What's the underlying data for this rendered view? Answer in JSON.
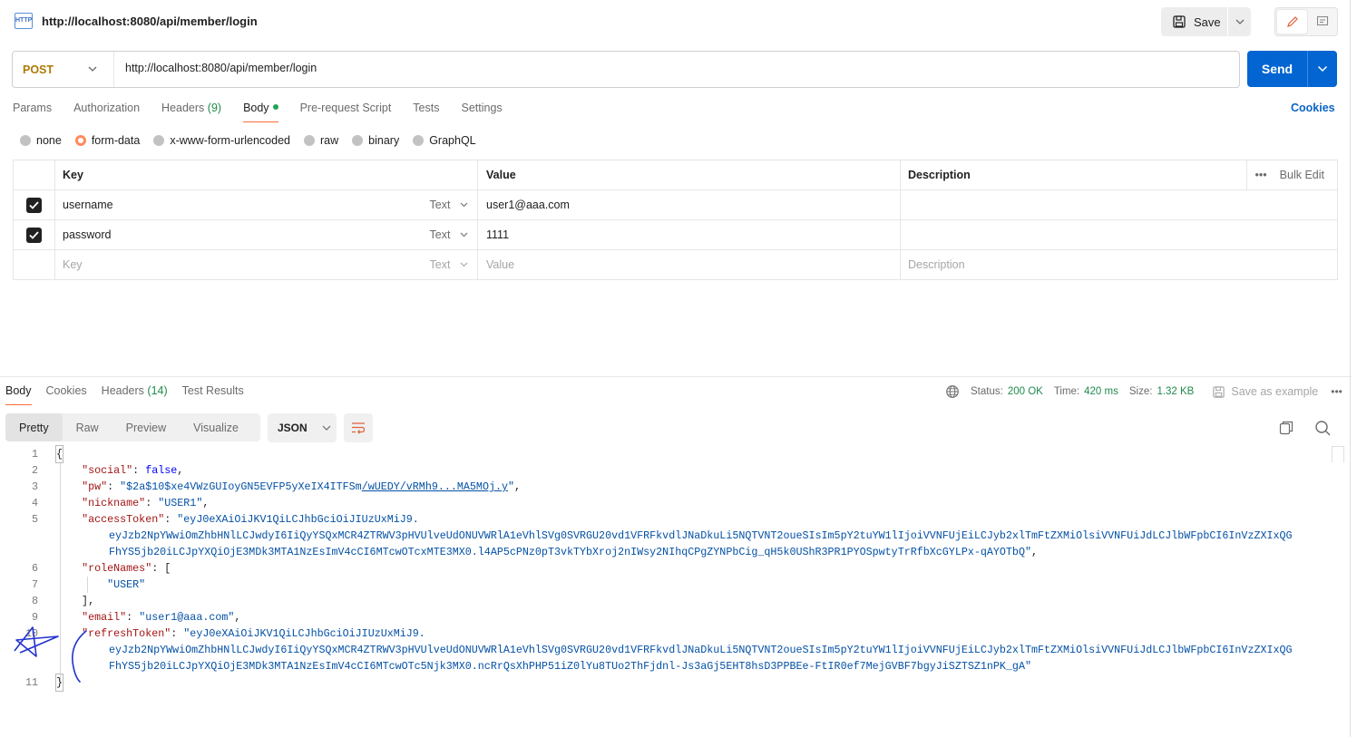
{
  "tab": {
    "icon": "http-icon",
    "icon_text": "HTTP",
    "title": "http://localhost:8080/api/member/login"
  },
  "toolbar": {
    "save_label": "Save"
  },
  "request": {
    "method": "POST",
    "url": "http://localhost:8080/api/member/login",
    "send_label": "Send",
    "tabs": [
      {
        "label": "Params"
      },
      {
        "label": "Authorization"
      },
      {
        "label": "Headers",
        "count": "(9)"
      },
      {
        "label": "Body"
      },
      {
        "label": "Pre-request Script"
      },
      {
        "label": "Tests"
      },
      {
        "label": "Settings"
      }
    ],
    "cookies_label": "Cookies",
    "body_types": [
      "none",
      "form-data",
      "x-www-form-urlencoded",
      "raw",
      "binary",
      "GraphQL"
    ],
    "selected_body_type": "form-data",
    "table": {
      "headers": {
        "key": "Key",
        "value": "Value",
        "description": "Description",
        "bulk_edit": "Bulk Edit"
      },
      "rows": [
        {
          "checked": true,
          "key": "username",
          "type": "Text",
          "value": "user1@aaa.com",
          "description": ""
        },
        {
          "checked": true,
          "key": "password",
          "type": "Text",
          "value": "1111",
          "description": ""
        }
      ],
      "placeholder": {
        "key": "Key",
        "type": "Text",
        "value": "Value",
        "description": "Description"
      }
    }
  },
  "response": {
    "tabs": [
      {
        "label": "Body"
      },
      {
        "label": "Cookies"
      },
      {
        "label": "Headers",
        "count": "(14)"
      },
      {
        "label": "Test Results"
      }
    ],
    "status_label": "Status:",
    "status": "200 OK",
    "time_label": "Time:",
    "time": "420 ms",
    "size_label": "Size:",
    "size": "1.32 KB",
    "save_example": "Save as example",
    "formats": [
      "Pretty",
      "Raw",
      "Preview",
      "Visualize"
    ],
    "active_format": "Pretty",
    "language": "JSON",
    "code": {
      "social_key": "\"social\"",
      "social_val": "false",
      "pw_key": "\"pw\"",
      "pw_a": "\"$2a$10$xe4VWzGUIoyGN5EVFP5yXeIX4ITFSm",
      "pw_b": "/wUEDY/vRMh9...MA5MOj.y",
      "pw_c": "\"",
      "nickname_key": "\"nickname\"",
      "nickname_val": "\"USER1\"",
      "access_key": "\"accessToken\"",
      "access_1": "\"eyJ0eXAiOiJKV1QiLCJhbGciOiJIUzUxMiJ9.",
      "access_2": "eyJzb2NpYWwiOmZhbHNlLCJwdyI6IiQyYSQxMCR4ZTRWV3pHVUlveUdONUVWRlA1eVhlSVg0SVRGU20vd1VFRFkvdlJNaDkuLi5NQTVNT2oueSIsIm5pY2tuYW1lIjoiVVNFUjEiLCJyb2xlTmFtZXMiOlsiVVNFUiJdLCJlbWFpbCI6InVzZXIxQG",
      "access_3": "FhYS5jb20iLCJpYXQiOjE3MDk3MTA1NzEsImV4cCI6MTcwOTcxMTE3MX0.l4AP5cPNz0pT3vkTYbXroj2nIWsy2NIhqCPgZYNPbCig_qH5k0UShR3PR1PYOSpwtyTrRfbXcGYLPx-qAYOTbQ\"",
      "roles_key": "\"roleNames\"",
      "roles_val": "\"USER\"",
      "email_key": "\"email\"",
      "email_val": "\"user1@aaa.com\"",
      "refresh_key": "\"refreshToken\"",
      "refresh_1": "\"eyJ0eXAiOiJKV1QiLCJhbGciOiJIUzUxMiJ9.",
      "refresh_2": "eyJzb2NpYWwiOmZhbHNlLCJwdyI6IiQyYSQxMCR4ZTRWV3pHVUlveUdONUVWRlA1eVhlSVg0SVRGU20vd1VFRFkvdlJNaDkuLi5NQTVNT2oueSIsIm5pY2tuYW1lIjoiVVNFUjEiLCJyb2xlTmFtZXMiOlsiVVNFUiJdLCJlbWFpbCI6InVzZXIxQG",
      "refresh_3": "FhYS5jb20iLCJpYXQiOjE3MDk3MTA1NzEsImV4cCI6MTcwOTc5Njk3MX0.ncRrQsXhPHP51iZ0lYu8TUo2ThFjdnl-Js3aGj5EHT8hsD3PPBEe-FtIR0ef7MejGVBF7bgyJiSZTSZ1nPK_gA\"",
      "line_numbers": [
        "1",
        "2",
        "3",
        "4",
        "5",
        "6",
        "7",
        "8",
        "9",
        "10",
        "11"
      ]
    }
  },
  "colors": {
    "accent": "#0265d2",
    "method": "#ad7a03",
    "status_ok": "#1f8a4c",
    "tab_underline": "#ff6c37"
  }
}
